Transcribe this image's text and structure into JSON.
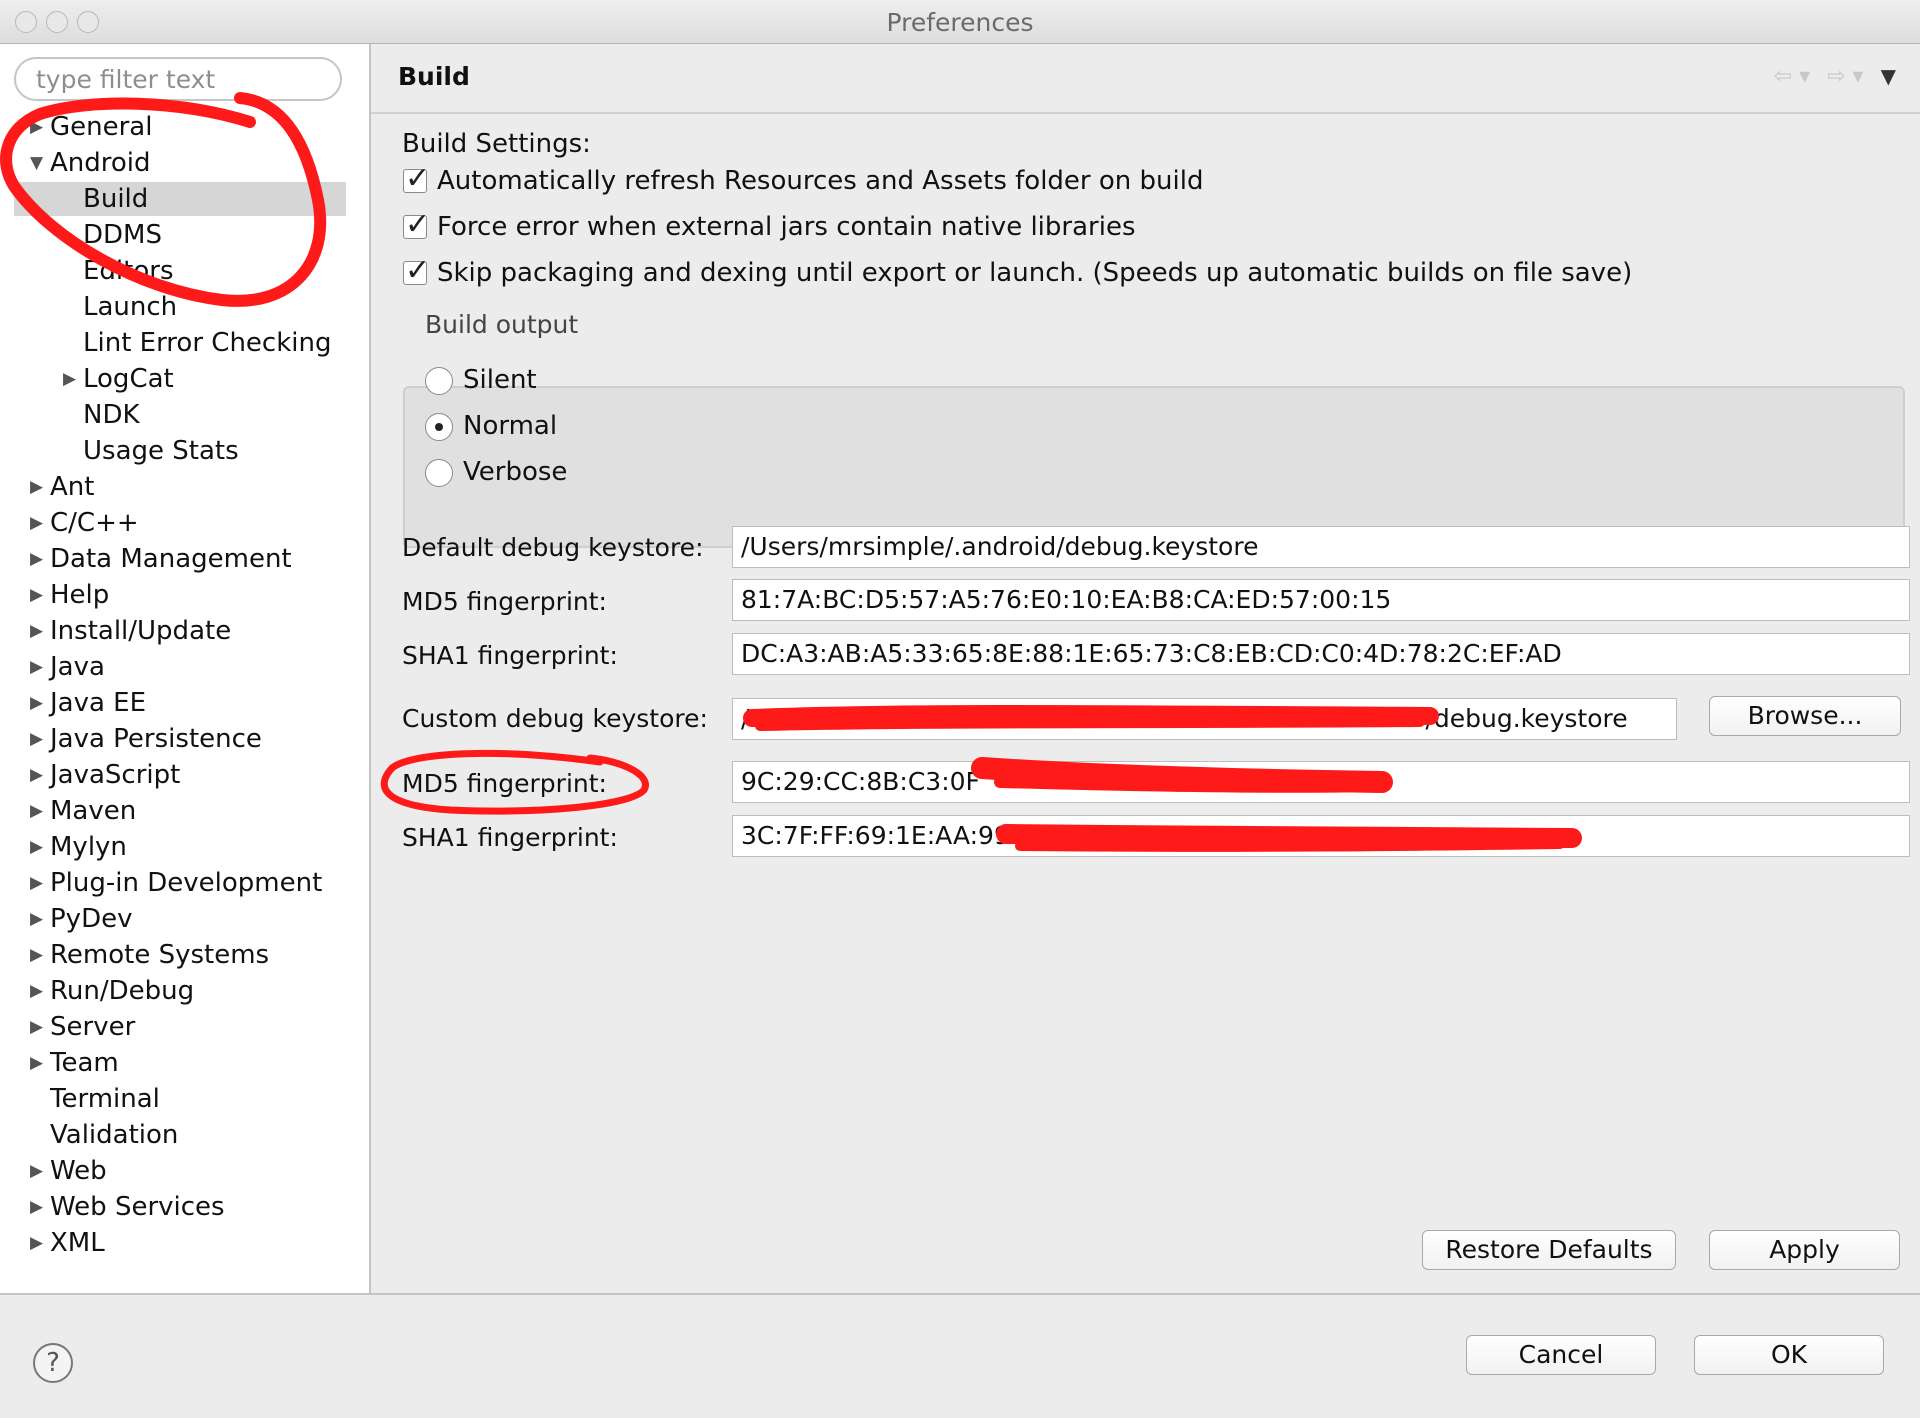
{
  "window": {
    "title": "Preferences"
  },
  "filter": {
    "placeholder": "type filter text"
  },
  "tree": {
    "items": [
      {
        "label": "General",
        "level": 0,
        "arrow": "right"
      },
      {
        "label": "Android",
        "level": 0,
        "arrow": "down"
      },
      {
        "label": "Build",
        "level": 1,
        "arrow": "none",
        "selected": true
      },
      {
        "label": "DDMS",
        "level": 1,
        "arrow": "none"
      },
      {
        "label": "Editors",
        "level": 1,
        "arrow": "none"
      },
      {
        "label": "Launch",
        "level": 1,
        "arrow": "none"
      },
      {
        "label": "Lint Error Checking",
        "level": 1,
        "arrow": "none"
      },
      {
        "label": "LogCat",
        "level": 1,
        "arrow": "right"
      },
      {
        "label": "NDK",
        "level": 1,
        "arrow": "none"
      },
      {
        "label": "Usage Stats",
        "level": 1,
        "arrow": "none"
      },
      {
        "label": "Ant",
        "level": 0,
        "arrow": "right"
      },
      {
        "label": "C/C++",
        "level": 0,
        "arrow": "right"
      },
      {
        "label": "Data Management",
        "level": 0,
        "arrow": "right"
      },
      {
        "label": "Help",
        "level": 0,
        "arrow": "right"
      },
      {
        "label": "Install/Update",
        "level": 0,
        "arrow": "right"
      },
      {
        "label": "Java",
        "level": 0,
        "arrow": "right"
      },
      {
        "label": "Java EE",
        "level": 0,
        "arrow": "right"
      },
      {
        "label": "Java Persistence",
        "level": 0,
        "arrow": "right"
      },
      {
        "label": "JavaScript",
        "level": 0,
        "arrow": "right"
      },
      {
        "label": "Maven",
        "level": 0,
        "arrow": "right"
      },
      {
        "label": "Mylyn",
        "level": 0,
        "arrow": "right"
      },
      {
        "label": "Plug-in Development",
        "level": 0,
        "arrow": "right"
      },
      {
        "label": "PyDev",
        "level": 0,
        "arrow": "right"
      },
      {
        "label": "Remote Systems",
        "level": 0,
        "arrow": "right"
      },
      {
        "label": "Run/Debug",
        "level": 0,
        "arrow": "right"
      },
      {
        "label": "Server",
        "level": 0,
        "arrow": "right"
      },
      {
        "label": "Team",
        "level": 0,
        "arrow": "right"
      },
      {
        "label": "Terminal",
        "level": 0,
        "arrow": "none"
      },
      {
        "label": "Validation",
        "level": 0,
        "arrow": "none"
      },
      {
        "label": "Web",
        "level": 0,
        "arrow": "right"
      },
      {
        "label": "Web Services",
        "level": 0,
        "arrow": "right"
      },
      {
        "label": "XML",
        "level": 0,
        "arrow": "right"
      }
    ]
  },
  "page": {
    "title": "Build",
    "nav": {
      "back_icon": "back-arrow-icon",
      "forward_icon": "forward-arrow-icon",
      "menu_icon": "view-menu-icon"
    },
    "build_settings_label": "Build Settings:",
    "checkboxes": [
      {
        "label": "Automatically refresh Resources and Assets folder on build",
        "checked": true
      },
      {
        "label": "Force error when external jars contain native libraries",
        "checked": true
      },
      {
        "label": "Skip packaging and dexing until export or launch. (Speeds up automatic builds on file save)",
        "checked": true
      }
    ],
    "build_output": {
      "label": "Build output",
      "options": [
        {
          "label": "Silent",
          "selected": false
        },
        {
          "label": "Normal",
          "selected": true
        },
        {
          "label": "Verbose",
          "selected": false
        }
      ]
    },
    "default_keystore": {
      "label": "Default debug keystore:",
      "value": "/Users/mrsimple/.android/debug.keystore",
      "md5_label": "MD5 fingerprint:",
      "md5_value": "81:7A:BC:D5:57:A5:76:E0:10:EA:B8:CA:ED:57:00:15",
      "sha1_label": "SHA1 fingerprint:",
      "sha1_value": "DC:A3:AB:A5:33:65:8E:88:1E:65:73:C8:EB:CD:C0:4D:78:2C:EF:AD"
    },
    "custom_keystore": {
      "label": "Custom debug keystore:",
      "value_prefix": "/",
      "value_suffix": "/debug.keystore",
      "browse_label": "Browse...",
      "md5_label": "MD5 fingerprint:",
      "md5_value": "9C:29:CC:8B:C3:0F",
      "sha1_label": "SHA1 fingerprint:",
      "sha1_value": "3C:7F:FF:69:1E:AA:99"
    },
    "restore_defaults_label": "Restore Defaults",
    "apply_label": "Apply"
  },
  "footer": {
    "help_icon": "help-icon",
    "help_glyph": "?",
    "cancel_label": "Cancel",
    "ok_label": "OK"
  },
  "annotation_color": "#ff1a1a"
}
